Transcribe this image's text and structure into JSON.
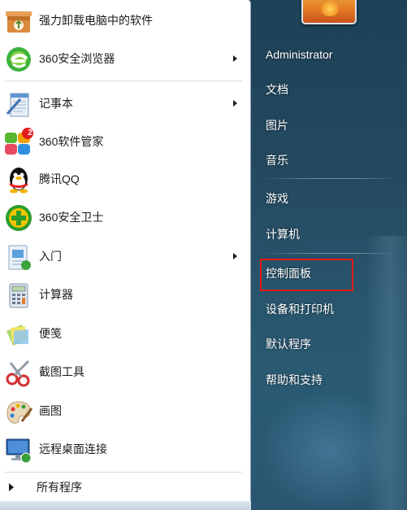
{
  "left_items": [
    {
      "label": "强力卸载电脑中的软件",
      "has_submenu": false,
      "icon": "uninstall-box-icon"
    },
    {
      "label": "360安全浏览器",
      "has_submenu": true,
      "icon": "browser-360-icon"
    },
    {
      "label": "记事本",
      "has_submenu": true,
      "icon": "notepad-icon"
    },
    {
      "label": "360软件管家",
      "has_submenu": false,
      "icon": "software-manager-icon",
      "badge": "2"
    },
    {
      "label": "腾讯QQ",
      "has_submenu": false,
      "icon": "qq-penguin-icon"
    },
    {
      "label": "360安全卫士",
      "has_submenu": false,
      "icon": "security-guard-icon"
    },
    {
      "label": "入门",
      "has_submenu": true,
      "icon": "getting-started-icon"
    },
    {
      "label": "计算器",
      "has_submenu": false,
      "icon": "calculator-icon"
    },
    {
      "label": "便笺",
      "has_submenu": false,
      "icon": "sticky-notes-icon"
    },
    {
      "label": "截图工具",
      "has_submenu": false,
      "icon": "snipping-tool-icon"
    },
    {
      "label": "画图",
      "has_submenu": false,
      "icon": "paint-icon"
    },
    {
      "label": "远程桌面连接",
      "has_submenu": false,
      "icon": "remote-desktop-icon"
    }
  ],
  "all_programs": "所有程序",
  "right_items": [
    {
      "label": "Administrator"
    },
    {
      "label": "文档"
    },
    {
      "label": "图片"
    },
    {
      "label": "音乐"
    },
    {
      "label": "游戏"
    },
    {
      "label": "计算机"
    },
    {
      "label": "控制面板",
      "highlighted": true
    },
    {
      "label": "设备和打印机"
    },
    {
      "label": "默认程序"
    },
    {
      "label": "帮助和支持"
    }
  ],
  "colors": {
    "highlight_border": "#e01a1a",
    "right_pane_bg": "#244a60",
    "left_pane_bg": "#ffffff"
  }
}
